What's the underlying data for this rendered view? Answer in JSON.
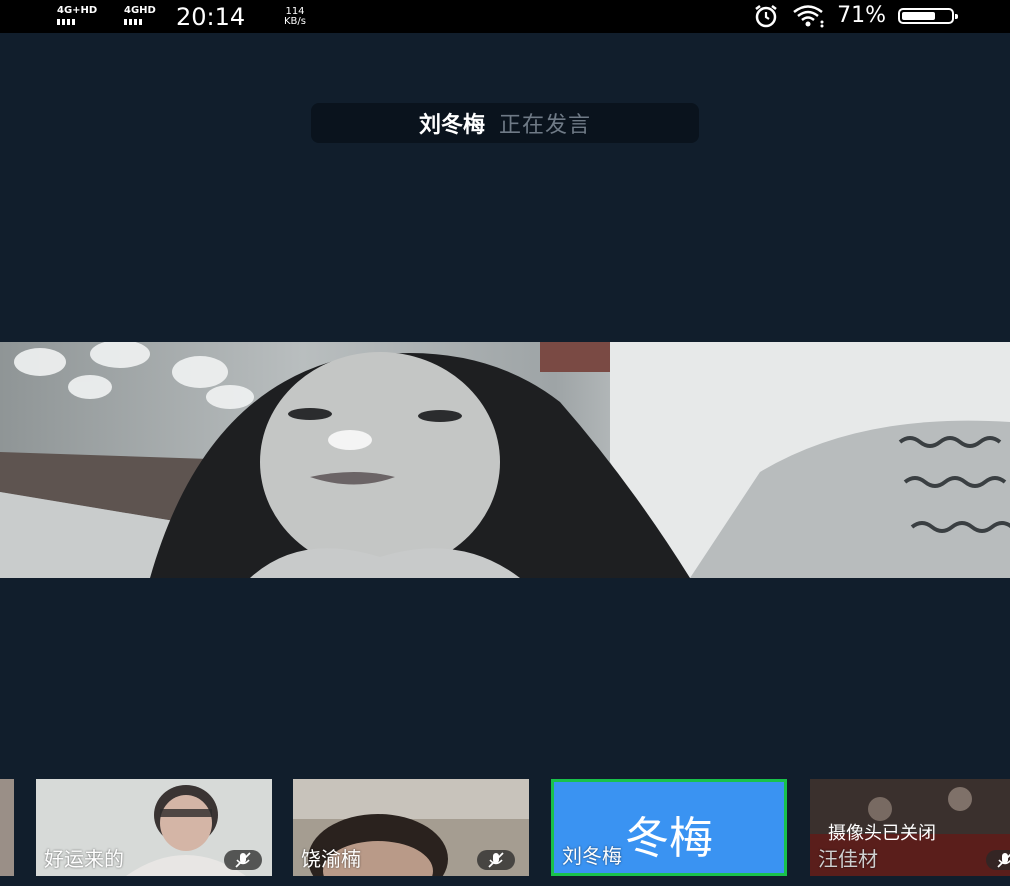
{
  "status_bar": {
    "sim1": "4G+HD",
    "sim2": "4GHD",
    "time": "20:14",
    "speed_value": "114",
    "speed_unit": "KB/s",
    "battery": "71%",
    "battery_level": 0.71,
    "icons": [
      "signal-icon",
      "alarm-icon",
      "wifi-icon",
      "battery-icon"
    ]
  },
  "speaking": {
    "name": "刘冬梅",
    "status": "正在发言"
  },
  "participants": [
    {
      "name": "",
      "muted": false
    },
    {
      "name": "好运来的",
      "muted": true
    },
    {
      "name": "饶渝楠",
      "muted": true
    },
    {
      "name": "刘冬梅",
      "avatar_text": "冬梅",
      "active": true,
      "muted": false
    },
    {
      "name": "汪佳材",
      "camera_status": "摄像头已关闭",
      "muted": true
    }
  ],
  "colors": {
    "background": "#111e2c",
    "active_border": "#19c24b",
    "avatar_bg": "#3a93f2"
  }
}
